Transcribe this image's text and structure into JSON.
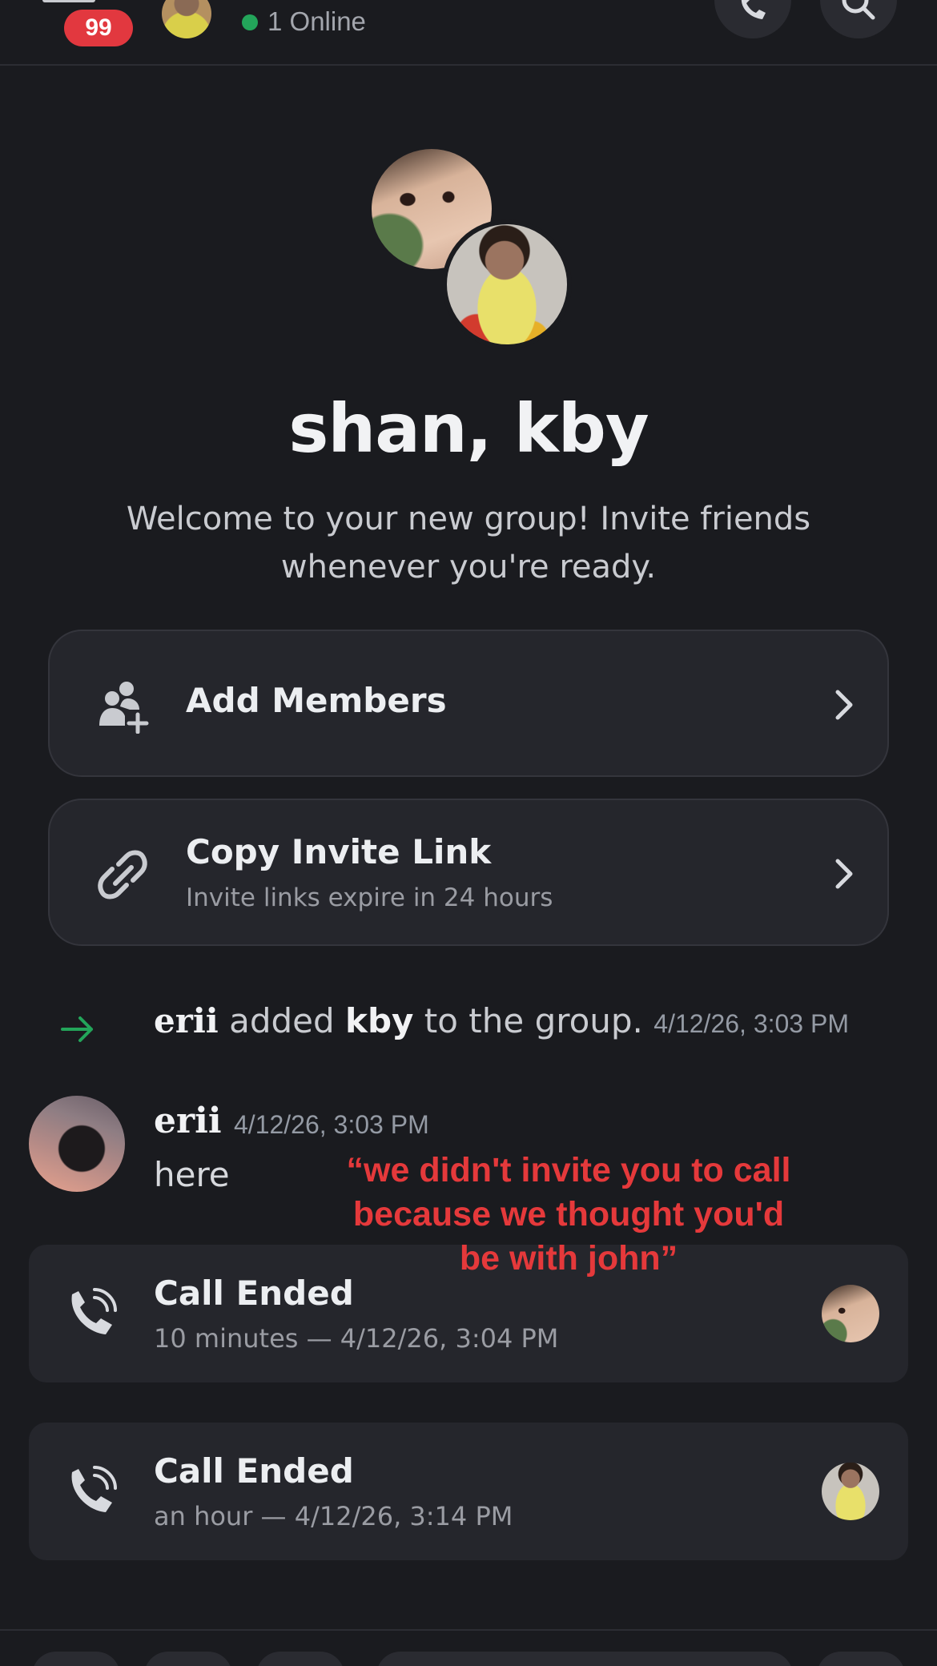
{
  "header": {
    "unread_count": "99",
    "online_text": "1 Online"
  },
  "group": {
    "title": "shan, kby",
    "welcome": "Welcome to your new group! Invite friends whenever you're ready."
  },
  "actions": {
    "add_members": {
      "label": "Add Members"
    },
    "copy_invite": {
      "label": "Copy Invite Link",
      "sublabel": "Invite links expire in 24 hours"
    }
  },
  "system_message": {
    "actor": "erii",
    "verb": "added",
    "target": "kby",
    "suffix": "to the group.",
    "timestamp": "4/12/26, 3:03 PM"
  },
  "message": {
    "author": "erii",
    "timestamp": "4/12/26, 3:03 PM",
    "text": "here"
  },
  "calls": [
    {
      "title": "Call Ended",
      "detail": "10 minutes — 4/12/26, 3:04 PM"
    },
    {
      "title": "Call Ended",
      "detail": "an hour — 4/12/26, 3:14 PM"
    }
  ],
  "overlay_quote": "“we didn't invite you to call because we thought you'd be with john”",
  "colors": {
    "background": "#1a1b1f",
    "card": "#25262c",
    "online": "#23a55a",
    "badge": "#e2383f",
    "overlay_text": "#e5393b"
  }
}
